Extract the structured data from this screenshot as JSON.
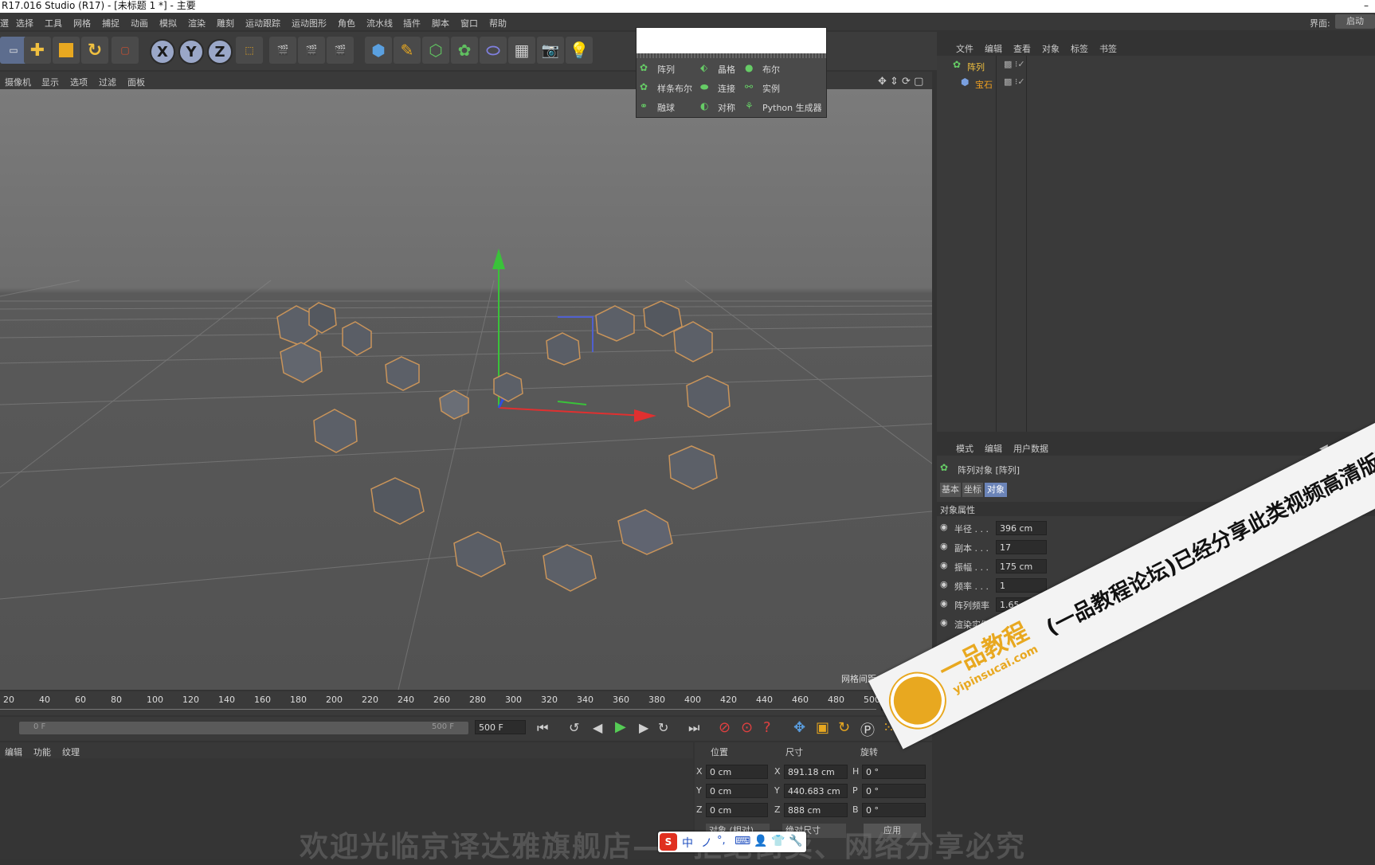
{
  "window": {
    "title": "R17.016 Studio (R17) - [未标题 1 *] - 主要",
    "close": "–"
  },
  "menu": [
    "選",
    "选择",
    "工具",
    "网格",
    "捕捉",
    "动画",
    "模拟",
    "渲染",
    "雕刻",
    "运动跟踪",
    "运动图形",
    "角色",
    "流水线",
    "插件",
    "脚本",
    "窗口",
    "帮助"
  ],
  "interface": {
    "label": "界面:",
    "value": "启动"
  },
  "toolbar": {
    "x": "X",
    "y": "Y",
    "z": "Z"
  },
  "viewport_menu": [
    "摄像机",
    "显示",
    "选项",
    "过滤",
    "面板"
  ],
  "grid_spacing": "网格间距 : 100 cm",
  "popup": {
    "items": [
      [
        "阵列",
        "晶格",
        "布尔"
      ],
      [
        "样条布尔",
        "连接",
        "实例"
      ],
      [
        "融球",
        "对称",
        "Python 生成器"
      ]
    ]
  },
  "objects_panel": {
    "tabs": [
      "文件",
      "编辑",
      "查看",
      "对象",
      "标签",
      "书签"
    ],
    "items": [
      {
        "name": "阵列"
      },
      {
        "name": "宝石"
      }
    ]
  },
  "attributes": {
    "tabs": [
      "模式",
      "编辑",
      "用户数据"
    ],
    "object_title": "阵列对象 [阵列]",
    "subtabs": [
      "基本",
      "坐标",
      "对象"
    ],
    "section": "对象属性",
    "props": [
      {
        "label": "半径 . . .",
        "value": "396 cm"
      },
      {
        "label": "副本 . . .",
        "value": "17"
      },
      {
        "label": "振幅 . . .",
        "value": "175 cm"
      },
      {
        "label": "频率 . . .",
        "value": "1"
      },
      {
        "label": "阵列频率",
        "value": "1.65"
      },
      {
        "label": "渲染实例",
        "value": ""
      }
    ]
  },
  "timeline": {
    "ticks": [
      "20",
      "40",
      "60",
      "80",
      "100",
      "120",
      "140",
      "160",
      "180",
      "200",
      "220",
      "240",
      "260",
      "280",
      "300",
      "320",
      "340",
      "360",
      "380",
      "400",
      "420",
      "440",
      "460",
      "480",
      "500"
    ],
    "current": "0 F",
    "range_start": "0 F",
    "range_end": "500 F",
    "end_field": "500 F"
  },
  "material_tabs": [
    "编辑",
    "功能",
    "纹理"
  ],
  "coords": {
    "headers": [
      "位置",
      "尺寸",
      "旋转"
    ],
    "rows": [
      {
        "axis": "X",
        "pos": "0 cm",
        "size": "891.18 cm",
        "rot_axis": "H",
        "rot": "0 °"
      },
      {
        "axis": "Y",
        "pos": "0 cm",
        "size": "440.683 cm",
        "rot_axis": "P",
        "rot": "0 °"
      },
      {
        "axis": "Z",
        "pos": "0 cm",
        "size": "888 cm",
        "rot_axis": "B",
        "rot": "0 °"
      }
    ],
    "dropdown1": "对象 (相对)",
    "dropdown2": "绝对尺寸",
    "apply": "应用"
  },
  "watermark": {
    "brand": "一品教程",
    "url": "yipinsucai.com",
    "banner": "(一品教程论坛)已经分享此类视频高清版可下载",
    "footer": "欢迎光临京译达雅旗舰店——拒绝倒卖、网络分享必究"
  },
  "ime": [
    "S",
    "中",
    "ノ",
    "°,",
    "⌨",
    "👤",
    "👕",
    "🔧"
  ]
}
